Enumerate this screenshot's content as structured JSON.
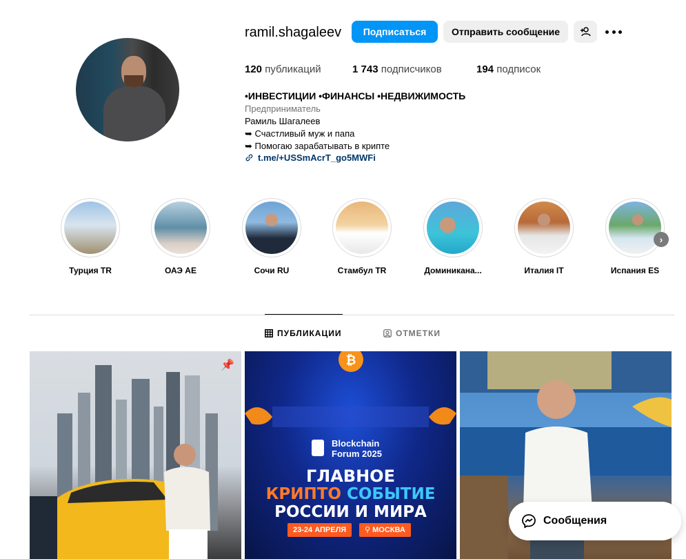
{
  "profile": {
    "username": "ramil.shagaleev",
    "follow_label": "Подписаться",
    "message_label": "Отправить сообщение",
    "posts_count": "120",
    "posts_label": "публикаций",
    "followers_count": "1 743",
    "followers_label": "подписчиков",
    "following_count": "194",
    "following_label": "подписок",
    "bio_title": "•ИНВЕСТИЦИИ •ФИНАНСЫ •НЕДВИЖИМОСТЬ",
    "category": "Предприниматель",
    "bio_lines": [
      "Рамиль Шагалеев",
      "➥ Счастливый муж и папа",
      "➥ Помогаю зарабатывать в крипте"
    ],
    "link": "t.me/+USSmAcrT_go5MWFi"
  },
  "highlights": [
    {
      "label": "Турция 🇹🇷",
      "display": "Турция TR"
    },
    {
      "label": "ОАЭ 🇦🇪",
      "display": "ОАЭ AE"
    },
    {
      "label": "Сочи 🇷🇺",
      "display": "Сочи RU"
    },
    {
      "label": "Стамбул 🇹🇷",
      "display": "Стамбул TR"
    },
    {
      "label": "Доминикана",
      "display": "Доминикана..."
    },
    {
      "label": "Италия 🇮🇹",
      "display": "Италия IT"
    },
    {
      "label": "Испания 🇪🇸",
      "display": "Испания ES"
    }
  ],
  "tabs": {
    "posts": "ПУБЛИКАЦИИ",
    "tagged": "ОТМЕТКИ"
  },
  "post2": {
    "brand": "Blockchain",
    "brand2": "Forum 2025",
    "line1": "ГЛАВНОЕ",
    "line2a": "КРИПТО",
    "line2b": "СОБЫТИЕ",
    "line3": "РОССИИ И МИРА",
    "date": "23-24 АПРЕЛЯ",
    "city": "МОСКВА"
  },
  "messages_label": "Сообщения",
  "colors": {
    "follow_button": "#0095f6",
    "secondary_button": "#efefef",
    "link": "#00376b",
    "muted_text": "#737373"
  }
}
